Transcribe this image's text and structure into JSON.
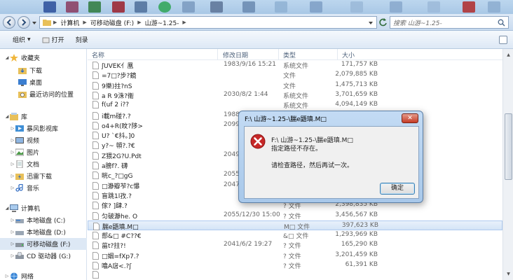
{
  "colors": {
    "accent": "#3c7fb1",
    "error": "#c62828"
  },
  "addressbar": {
    "crumbs": [
      "计算机",
      "可移动磁盘 (F:)",
      "山游~1.25-"
    ],
    "search_placeholder": "搜索 山游~1.25-"
  },
  "toolbar": {
    "organize": "组织",
    "open": "打开",
    "burn": "刻录"
  },
  "navpane": {
    "favorites": "收藏夹",
    "downloads": "下载",
    "desktop": "桌面",
    "recent": "最近访问的位置",
    "libraries": "库",
    "videos_lib": "暴风影视库",
    "videos": "视频",
    "pictures": "图片",
    "documents": "文档",
    "thunder": "迅雷下载",
    "music": "音乐",
    "computer": "计算机",
    "local_c": "本地磁盘 (C:)",
    "local_d": "本地磁盘 (D:)",
    "removable_f": "可移动磁盘 (F:)",
    "cd_g": "CD 驱动器 (G:)",
    "network": "网络"
  },
  "columns": {
    "name": "名称",
    "date": "修改日期",
    "type": "类型",
    "size": "大小"
  },
  "files": [
    {
      "name": "ʃUVEK亻凰",
      "date": "1983/9/16 15:21",
      "type": "系统文件",
      "size": "171,757 KB"
    },
    {
      "name": "=7□?步?鏡",
      "date": "",
      "type": "文件",
      "size": "2,079,885 KB"
    },
    {
      "name": "9樂)拄?nS",
      "date": "",
      "type": "文件",
      "size": "1,475,713 KB"
    },
    {
      "name": "a R 9洙?衞",
      "date": "2030/8/2 1:44",
      "type": "系统文件",
      "size": "3,701,659 KB"
    },
    {
      "name": "f(uf 2 i??",
      "date": "",
      "type": "系统文件",
      "size": "4,094,149 KB"
    },
    {
      "name": "i載m碰?.?",
      "date": "1988",
      "type": "",
      "size": ""
    },
    {
      "name": "o4+R(旼?陊>",
      "date": "2099",
      "type": "",
      "size": ""
    },
    {
      "name": "U?  `€抖。]0",
      "date": "",
      "type": "",
      "size": ""
    },
    {
      "name": "y?~ 顇?.?€",
      "date": "",
      "type": "",
      "size": ""
    },
    {
      "name": "Z猥2G?U.Pdt",
      "date": "2049",
      "type": "",
      "size": ""
    },
    {
      "name": "a膀f?. 礴",
      "date": "",
      "type": "",
      "size": ""
    },
    {
      "name": "晄c_?□gG",
      "date": "2055",
      "type": "",
      "size": ""
    },
    {
      "name": "□瀞瓣苲?c懪",
      "date": "2047",
      "type": "",
      "size": ""
    },
    {
      "name": "盲跳1l孜.?",
      "date": "",
      "type": "",
      "size": ""
    },
    {
      "name": "傢?  ]肆.?",
      "date": "",
      "type": "? 文件",
      "size": "2,398,835 KB"
    },
    {
      "name": "匀破瀞he.   O",
      "date": "2055/12/30 15:00",
      "type": "? 文件",
      "size": "3,456,567 KB"
    },
    {
      "name": "腨e鼯瑱.M□",
      "date": "",
      "type": "M□ 文件",
      "size": "397,623 KB"
    },
    {
      "name": "郻&□ #C??€",
      "date": "",
      "type": "&□ 文件",
      "size": "1,293,969 KB"
    },
    {
      "name": "菑t?拄?!",
      "date": "2041/6/2 19:27",
      "type": "? 文件",
      "size": "165,290 KB"
    },
    {
      "name": "□姻=fXp7.?",
      "date": "",
      "type": "? 文件",
      "size": "3,201,459 KB"
    },
    {
      "name": "噏A扂<.?ʃ",
      "date": "",
      "type": "? 文件",
      "size": "61,391 KB"
    },
    {
      "name": "",
      "date": "",
      "type": "",
      "size": ""
    }
  ],
  "dialog": {
    "title": "F:\\  山游~1.25-\\腨e鼯瑱.M□",
    "close": "✕",
    "path": "F:\\  山游~1.25-\\腨e鼯瑱.M□",
    "message": "指定路径不存在。",
    "hint": "请检查路径，然后再试一次。",
    "ok": "确定"
  }
}
